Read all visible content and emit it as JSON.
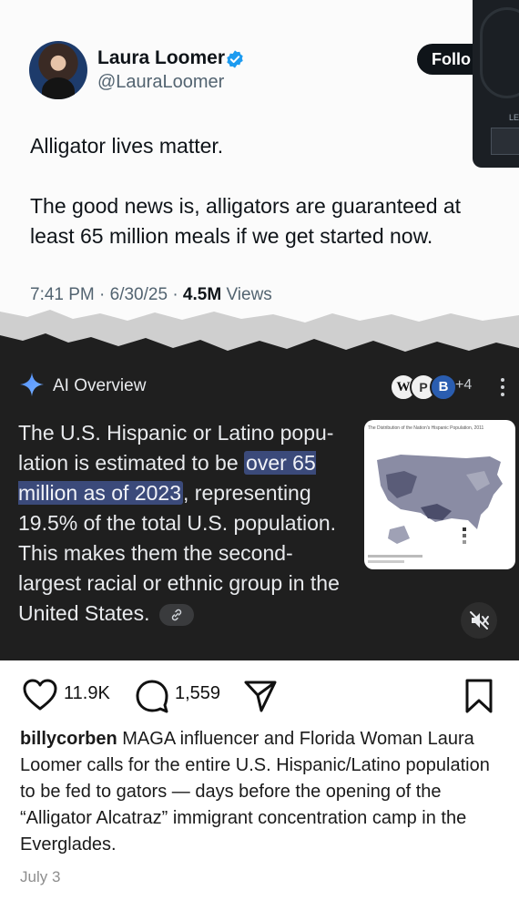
{
  "tweet": {
    "author_name": "Laura Loomer",
    "author_handle": "@LauraLoomer",
    "follow_label": "Follo",
    "text_lines": [
      "Alligator lives matter.",
      "The good news is, alligators are guaranteed at",
      "least 65 million meals if we get started now."
    ],
    "time": "7:41 PM · 6/30/25 · ",
    "views_count": "4.5M",
    "views_label": " Views",
    "video_label": "LE"
  },
  "ai_overview": {
    "title": "AI Overview",
    "sources": [
      "W",
      "P",
      "B"
    ],
    "sources_more": "+4",
    "text_before": "The U.S. Hispanic or Latino popu-lation is estimated to be ",
    "text_highlight": "over 65 million as of 2023",
    "text_after": ", representing 19.5% of the total U.S. population. This makes them the second-largest racial or ethnic group in the United States.",
    "map_caption": "The Distribution of the Nation's Hispanic Population, 2011"
  },
  "post": {
    "likes": "11.9K",
    "comments": "1,559",
    "username": "billycorben",
    "caption": " MAGA influencer and Florida Woman Laura Loomer calls for the entire U.S. Hispanic/Latino population to be fed to gators — days before the opening of the “Alligator Alcatraz” immigrant concentration camp in the Everglades.",
    "date": "July 3"
  },
  "colors": {
    "ai_bg": "#1f1f1f",
    "highlight": "#3b4a7a",
    "verified": "#1d9bf0",
    "follow_bg": "#0f1419"
  },
  "icons": [
    "verified-badge-icon",
    "sparkle-icon",
    "more-options-icon",
    "link-icon",
    "mute-icon",
    "heart-icon",
    "comment-icon",
    "share-icon",
    "bookmark-icon"
  ]
}
